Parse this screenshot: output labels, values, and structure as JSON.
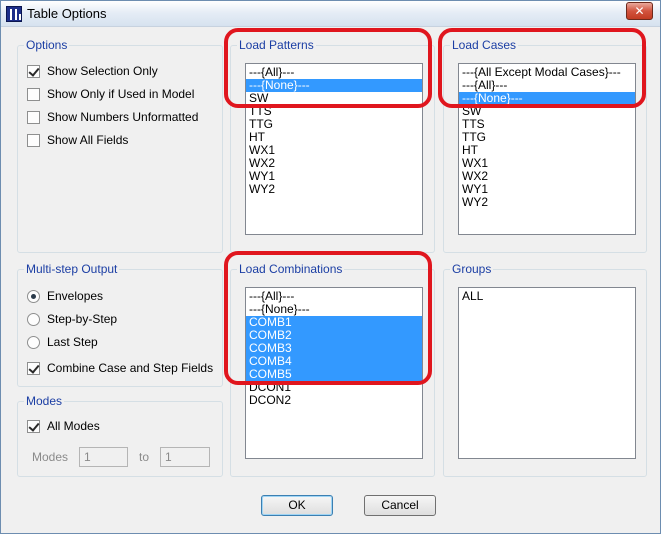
{
  "window": {
    "title": "Table Options"
  },
  "options": {
    "label": "Options",
    "items": [
      {
        "label": "Show Selection Only",
        "checked": true
      },
      {
        "label": "Show Only if Used in Model",
        "checked": false
      },
      {
        "label": "Show Numbers Unformatted",
        "checked": false
      },
      {
        "label": "Show All Fields",
        "checked": false
      }
    ]
  },
  "load_patterns": {
    "label": "Load Patterns",
    "items": [
      "---{All}---",
      "---{None}---",
      "SW",
      "TTS",
      "TTG",
      "HT",
      "WX1",
      "WX2",
      "WY1",
      "WY2"
    ],
    "selected": [
      1
    ]
  },
  "load_cases": {
    "label": "Load Cases",
    "items": [
      "---{All Except Modal Cases}---",
      "---{All}---",
      "---{None}---",
      "SW",
      "TTS",
      "TTG",
      "HT",
      "WX1",
      "WX2",
      "WY1",
      "WY2"
    ],
    "selected": [
      2
    ]
  },
  "multistep": {
    "label": "Multi-step Output",
    "radios": [
      {
        "label": "Envelopes",
        "checked": true
      },
      {
        "label": "Step-by-Step",
        "checked": false
      },
      {
        "label": "Last Step",
        "checked": false
      }
    ],
    "combine": {
      "label": "Combine Case and Step Fields",
      "checked": true
    }
  },
  "load_combinations": {
    "label": "Load Combinations",
    "items": [
      "---{All}---",
      "---{None}---",
      "COMB1",
      "COMB2",
      "COMB3",
      "COMB4",
      "COMB5",
      "DCON1",
      "DCON2"
    ],
    "selected": [
      2,
      3,
      4,
      5,
      6
    ]
  },
  "groups": {
    "label": "Groups",
    "items": [
      "ALL"
    ]
  },
  "modes": {
    "label": "Modes",
    "all_modes": {
      "label": "All Modes",
      "checked": true
    },
    "from_label": "Modes",
    "from_value": "1",
    "to_label": "to",
    "to_value": "1"
  },
  "buttons": {
    "ok": "OK",
    "cancel": "Cancel"
  },
  "icons": {
    "app": "etabs-app-icon",
    "close": "close-icon"
  },
  "colors": {
    "selection": "#3399ff",
    "highlight": "#e0161e",
    "group_label": "#1b3ea4"
  }
}
